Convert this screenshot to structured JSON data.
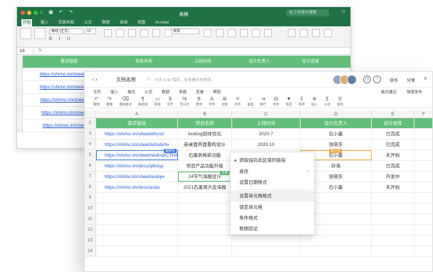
{
  "bg": {
    "doc_title": "表格",
    "quick_access": "⌂ ▣ ↶ ↷",
    "search_placeholder": "在工作表中搜索",
    "account": "☺",
    "tabs": [
      "开始",
      "插入",
      "页面布局",
      "公式",
      "数据",
      "审阅",
      "视图",
      "Acrobat"
    ],
    "font_name": "等线 (正文)",
    "font_size": "12",
    "format_glyphs": "B I U",
    "number_format": "常规",
    "cell_ref": "E8",
    "fx": "fx",
    "headers": [
      "需求链接",
      "项目名称",
      "上线时间",
      "设计负责人",
      "设计进度"
    ],
    "rows": [
      {
        "link": "https://shimo.im/sheet/dhsnd",
        "name": "looking到体优化",
        "date": "2020.7",
        "owner": "石小墨",
        "status": "已完成"
      },
      {
        "link": "https://shimo.im/sheet/lsjsksl",
        "name": "",
        "date": "",
        "owner": "",
        "status": ""
      },
      {
        "link": "https://shimo.im/sheet/lsjsks",
        "name": "",
        "date": "",
        "owner": "",
        "status": ""
      },
      {
        "link": "https://shimo.im/sheet/lsjsk",
        "name": "",
        "date": "",
        "owner": "",
        "status": ""
      },
      {
        "link": "https://shimo.im/sheet/lsjs",
        "name": "",
        "date": "",
        "owner": "",
        "status": ""
      }
    ]
  },
  "fg": {
    "nav": "‹   ›",
    "title": "文档名称",
    "star": "☆",
    "saved": "今天 9:42 保存，去查看历史修改",
    "buttons": {
      "collab": "协作",
      "share": "分享"
    },
    "menu": [
      "文件",
      "插入",
      "格式",
      "公式",
      "数据",
      "表格",
      "查看",
      "帮助"
    ],
    "menu_right": [
      "格式建议",
      "快速发布"
    ],
    "toolbar": [
      {
        "g": "↶",
        "l": "撤销"
      },
      {
        "g": "↷",
        "l": "重做"
      },
      {
        "g": "⌫",
        "l": "清除格式"
      },
      {
        "g": "¶",
        "l": "格式刷"
      },
      {
        "g": "▭",
        "l": "常规"
      },
      {
        "g": "$",
        "l": "货币"
      },
      {
        "g": "%",
        "l": "百分比"
      },
      {
        "g": "B",
        "l": "粗体"
      },
      {
        "g": "A",
        "l": "字色"
      },
      {
        "g": "⊞",
        "l": "边框"
      },
      {
        "g": "≡",
        "l": "对齐"
      },
      {
        "g": "↕",
        "l": "垂直"
      },
      {
        "g": "⇥",
        "l": "换行"
      },
      {
        "g": "⊟",
        "l": "合并"
      },
      {
        "g": "▼",
        "l": "筛选"
      },
      {
        "g": "↧",
        "l": "排序"
      },
      {
        "g": "⊕",
        "l": "插入"
      },
      {
        "g": "Σ",
        "l": "公式"
      },
      {
        "g": "⚲",
        "l": "查找"
      }
    ],
    "col_letters": [
      "A",
      "B",
      "C",
      "D",
      "E",
      "F"
    ],
    "headers": [
      "需求链接",
      "项目名称",
      "上线时间",
      "设计负责人",
      "设计进度"
    ],
    "rows": [
      {
        "n": "2",
        "header": true
      },
      {
        "n": "3",
        "link": "https://shimo.im/sheet/dhsnd",
        "name": "looking到体优化",
        "date": "2020.7",
        "owner": "石小墨",
        "status": "已完成"
      },
      {
        "n": "4",
        "link": "https://shimo.im/sheet/whsdvhv",
        "name": "新桌面界面重构设计",
        "date": "2020.10",
        "owner": "张晓东",
        "status": "已完成"
      },
      {
        "n": "5",
        "link": "https://shimo.im/sheet/skdnsbCTtVKh",
        "name": "石墨表格新功能",
        "date": "",
        "owner": "石小墨",
        "status": "未开始"
      },
      {
        "n": "6",
        "link": "https://shimo.im/docs/qbhuyj",
        "name": "项目产品功能升级",
        "date": "",
        "owner": "孙海",
        "status": "已完成"
      },
      {
        "n": "7",
        "link": "https://shimo.im/sheet/asdqw",
        "name": "24节气海报设计",
        "date": "",
        "owner": "张晓东",
        "status": "开发中"
      },
      {
        "n": "8",
        "link": "https://shimo.im/docs/asda",
        "name": "2021石墨周大会海报",
        "date": "",
        "owner": "石小墨",
        "status": "未开始"
      },
      {
        "n": "9"
      },
      {
        "n": "10"
      },
      {
        "n": "11"
      },
      {
        "n": "12"
      },
      {
        "n": "13"
      },
      {
        "n": "14"
      }
    ],
    "tags": {
      "cursor_a": "张晓东",
      "cursor_b": "李小兰",
      "cursor_c": "王鑫"
    },
    "context_menu": [
      "获取指向此区域的链接",
      "排序",
      "设置日期格式",
      "设置单元格格式",
      "锁定单元格",
      "条件格式",
      "数据验证"
    ]
  },
  "colors": {
    "header_green": "#63be7b",
    "excel_green": "#1f7244",
    "link_blue": "#1a56d6",
    "select_blue": "#3f7fe0"
  }
}
